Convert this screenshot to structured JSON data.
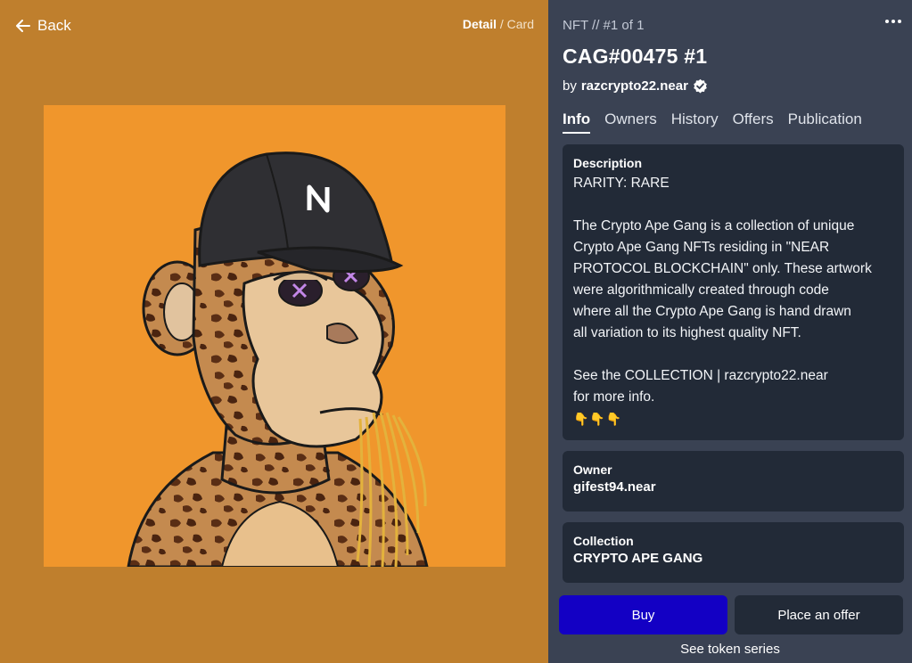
{
  "nav": {
    "back_label": "Back"
  },
  "view_toggle": {
    "active": "Detail",
    "separator": "/",
    "inactive": "Card"
  },
  "header": {
    "breadcrumb": "NFT // #1 of 1",
    "title": "CAG#00475 #1",
    "by_prefix": "by",
    "creator": "razcrypto22.near"
  },
  "tabs": [
    "Info",
    "Owners",
    "History",
    "Offers",
    "Publication"
  ],
  "description": {
    "label": "Description",
    "rarity": "RARITY: RARE",
    "body_lines": [
      "The Crypto Ape Gang is a collection of unique",
      "Crypto Ape Gang NFTs residing in \"NEAR",
      "PROTOCOL BLOCKCHAIN\" only. These artwork",
      "were algorithmically created through code",
      "where all the Crypto Ape Gang is hand drawn",
      "all variation to its highest quality NFT."
    ],
    "see_line": "See the COLLECTION | razcrypto22.near",
    "more_line": "for more info.",
    "hands": "👇👇👇"
  },
  "owner": {
    "label": "Owner",
    "value": "gifest94.near"
  },
  "collection": {
    "label": "Collection",
    "value": "CRYPTO APE GANG"
  },
  "actions": {
    "buy": "Buy",
    "offer": "Place an offer",
    "series": "See token series"
  },
  "colors": {
    "left_bg": "#bf7f2d",
    "art_bg": "#f0962c",
    "panel_bg": "#3a4253",
    "card_bg": "#222a37",
    "buy_button": "#1300c4"
  }
}
